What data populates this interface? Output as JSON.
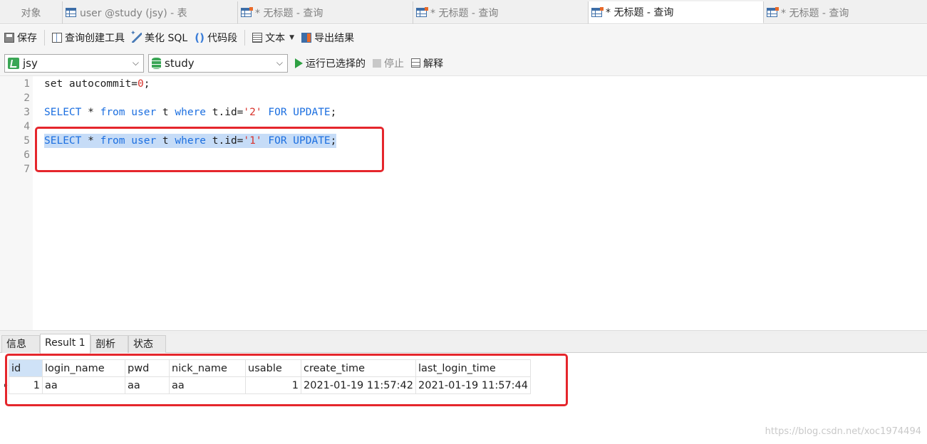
{
  "tabs": [
    {
      "label": "对象",
      "icon": "",
      "active": false
    },
    {
      "label": "user @study (jsy) - 表",
      "icon": "table-icon",
      "active": false
    },
    {
      "label": "* 无标题 - 查询",
      "icon": "query-icon",
      "active": false
    },
    {
      "label": "* 无标题 - 查询",
      "icon": "query-icon",
      "active": false
    },
    {
      "label": "* 无标题 - 查询",
      "icon": "query-icon",
      "active": true
    },
    {
      "label": "* 无标题 - 查询",
      "icon": "query-icon",
      "active": false
    }
  ],
  "toolbar": {
    "save": "保存",
    "query_builder": "查询创建工具",
    "beautify": "美化 SQL",
    "snippet": "代码段",
    "text": "文本",
    "export": "导出结果"
  },
  "connection": {
    "connection_value": "jsy",
    "database_value": "study",
    "run_selected": "运行已选择的",
    "stop": "停止",
    "explain": "解释"
  },
  "editor": {
    "lines": [
      {
        "num": "1",
        "tokens": [
          [
            "",
            "set autocommit="
          ],
          [
            "num",
            "0"
          ],
          [
            "",
            ";"
          ]
        ]
      },
      {
        "num": "2",
        "tokens": []
      },
      {
        "num": "3",
        "tokens": [
          [
            "kw",
            "SELECT"
          ],
          [
            "",
            " * "
          ],
          [
            "kw",
            "from"
          ],
          [
            "",
            " "
          ],
          [
            "kw",
            "user"
          ],
          [
            "",
            " t "
          ],
          [
            "kw",
            "where"
          ],
          [
            "",
            " t.id="
          ],
          [
            "str",
            "'2'"
          ],
          [
            "",
            " "
          ],
          [
            "kw",
            "FOR UPDATE"
          ],
          [
            "",
            ";"
          ]
        ]
      },
      {
        "num": "4",
        "tokens": []
      },
      {
        "num": "5",
        "selected": true,
        "tokens": [
          [
            "kw",
            "SELECT"
          ],
          [
            "",
            " * "
          ],
          [
            "kw",
            "from"
          ],
          [
            "",
            " "
          ],
          [
            "kw",
            "user"
          ],
          [
            "",
            " t "
          ],
          [
            "kw",
            "where"
          ],
          [
            "",
            " t.id="
          ],
          [
            "str",
            "'1'"
          ],
          [
            "",
            " "
          ],
          [
            "kw",
            "FOR UPDATE"
          ],
          [
            "",
            ";"
          ]
        ]
      },
      {
        "num": "6",
        "tokens": []
      },
      {
        "num": "7",
        "tokens": []
      }
    ]
  },
  "result_tabs": [
    {
      "label": "信息",
      "active": false
    },
    {
      "label": "Result 1",
      "active": true
    },
    {
      "label": "剖析",
      "active": false
    },
    {
      "label": "状态",
      "active": false
    }
  ],
  "result_grid": {
    "columns": [
      "id",
      "login_name",
      "pwd",
      "nick_name",
      "usable",
      "create_time",
      "last_login_time"
    ],
    "rows": [
      [
        "1",
        "aa",
        "aa",
        "aa",
        "1",
        "2021-01-19 11:57:42",
        "2021-01-19 11:57:44"
      ]
    ]
  },
  "watermark": "https://blog.csdn.net/xoc1974494",
  "colors": {
    "keyword": "#1c6fe0",
    "string": "#d8322b",
    "selection": "#c6dcf7",
    "annotation_box": "#e5262c"
  }
}
